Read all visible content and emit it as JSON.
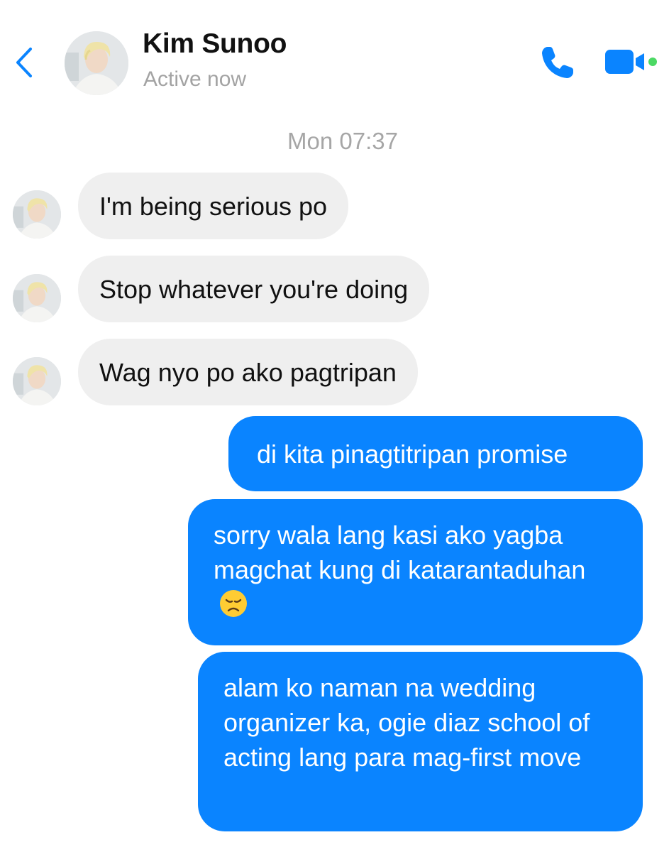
{
  "header": {
    "back_icon": "chevron-left-icon",
    "contact_name": "Kim Sunoo",
    "status": "Active now",
    "call_icon": "phone-icon",
    "video_icon": "video-camera-icon",
    "presence_color": "#4cd964"
  },
  "conversation": {
    "timestamp": "Mon 07:37",
    "incoming": [
      {
        "text": "I'm being serious po"
      },
      {
        "text": "Stop whatever you're doing"
      },
      {
        "text": "Wag nyo po ako pagtripan"
      }
    ],
    "outgoing": [
      {
        "text": "di kita pinagtitripan promise"
      },
      {
        "text": "sorry wala lang kasi ako yagba magchat kung di katarantaduhan",
        "emoji": "disappointed-face-icon"
      },
      {
        "text": "alam ko naman na wedding organizer ka, ogie diaz school of acting lang para mag-first move"
      }
    ]
  },
  "colors": {
    "accent": "#0a84ff",
    "incoming_bubble": "#efefef",
    "muted_text": "#a3a3a3"
  }
}
